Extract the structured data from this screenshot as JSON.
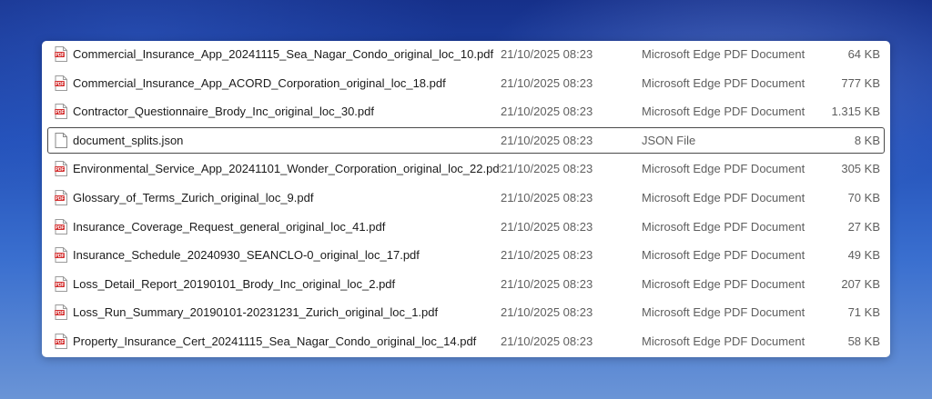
{
  "files": [
    {
      "name": "Commercial_Insurance_App_20241115_Sea_Nagar_Condo_original_loc_10.pdf",
      "date": "21/10/2025 08:23",
      "type": "Microsoft Edge PDF Document",
      "size": "64 KB",
      "icon": "pdf-file-icon"
    },
    {
      "name": "Commercial_Insurance_App_ACORD_Corporation_original_loc_18.pdf",
      "date": "21/10/2025 08:23",
      "type": "Microsoft Edge PDF Document",
      "size": "777 KB",
      "icon": "pdf-file-icon"
    },
    {
      "name": "Contractor_Questionnaire_Brody_Inc_original_loc_30.pdf",
      "date": "21/10/2025 08:23",
      "type": "Microsoft Edge PDF Document",
      "size": "1.315 KB",
      "icon": "pdf-file-icon"
    },
    {
      "name": "document_splits.json",
      "date": "21/10/2025 08:23",
      "type": "JSON File",
      "size": "8 KB",
      "icon": "json-file-icon"
    },
    {
      "name": "Environmental_Service_App_20241101_Wonder_Corporation_original_loc_22.pdf",
      "date": "21/10/2025 08:23",
      "type": "Microsoft Edge PDF Document",
      "size": "305 KB",
      "icon": "pdf-file-icon"
    },
    {
      "name": "Glossary_of_Terms_Zurich_original_loc_9.pdf",
      "date": "21/10/2025 08:23",
      "type": "Microsoft Edge PDF Document",
      "size": "70 KB",
      "icon": "pdf-file-icon"
    },
    {
      "name": "Insurance_Coverage_Request_general_original_loc_41.pdf",
      "date": "21/10/2025 08:23",
      "type": "Microsoft Edge PDF Document",
      "size": "27 KB",
      "icon": "pdf-file-icon"
    },
    {
      "name": "Insurance_Schedule_20240930_SEANCLO-0_original_loc_17.pdf",
      "date": "21/10/2025 08:23",
      "type": "Microsoft Edge PDF Document",
      "size": "49 KB",
      "icon": "pdf-file-icon"
    },
    {
      "name": "Loss_Detail_Report_20190101_Brody_Inc_original_loc_2.pdf",
      "date": "21/10/2025 08:23",
      "type": "Microsoft Edge PDF Document",
      "size": "207 KB",
      "icon": "pdf-file-icon"
    },
    {
      "name": "Loss_Run_Summary_20190101-20231231_Zurich_original_loc_1.pdf",
      "date": "21/10/2025 08:23",
      "type": "Microsoft Edge PDF Document",
      "size": "71 KB",
      "icon": "pdf-file-icon"
    },
    {
      "name": "Property_Insurance_Cert_20241115_Sea_Nagar_Condo_original_loc_14.pdf",
      "date": "21/10/2025 08:23",
      "type": "Microsoft Edge PDF Document",
      "size": "58 KB",
      "icon": "pdf-file-icon"
    }
  ],
  "focused_index": 3,
  "colors": {
    "pdf_red": "#d32f2f",
    "panel_bg": "#ffffff",
    "desktop_blue": "#2350b8"
  }
}
